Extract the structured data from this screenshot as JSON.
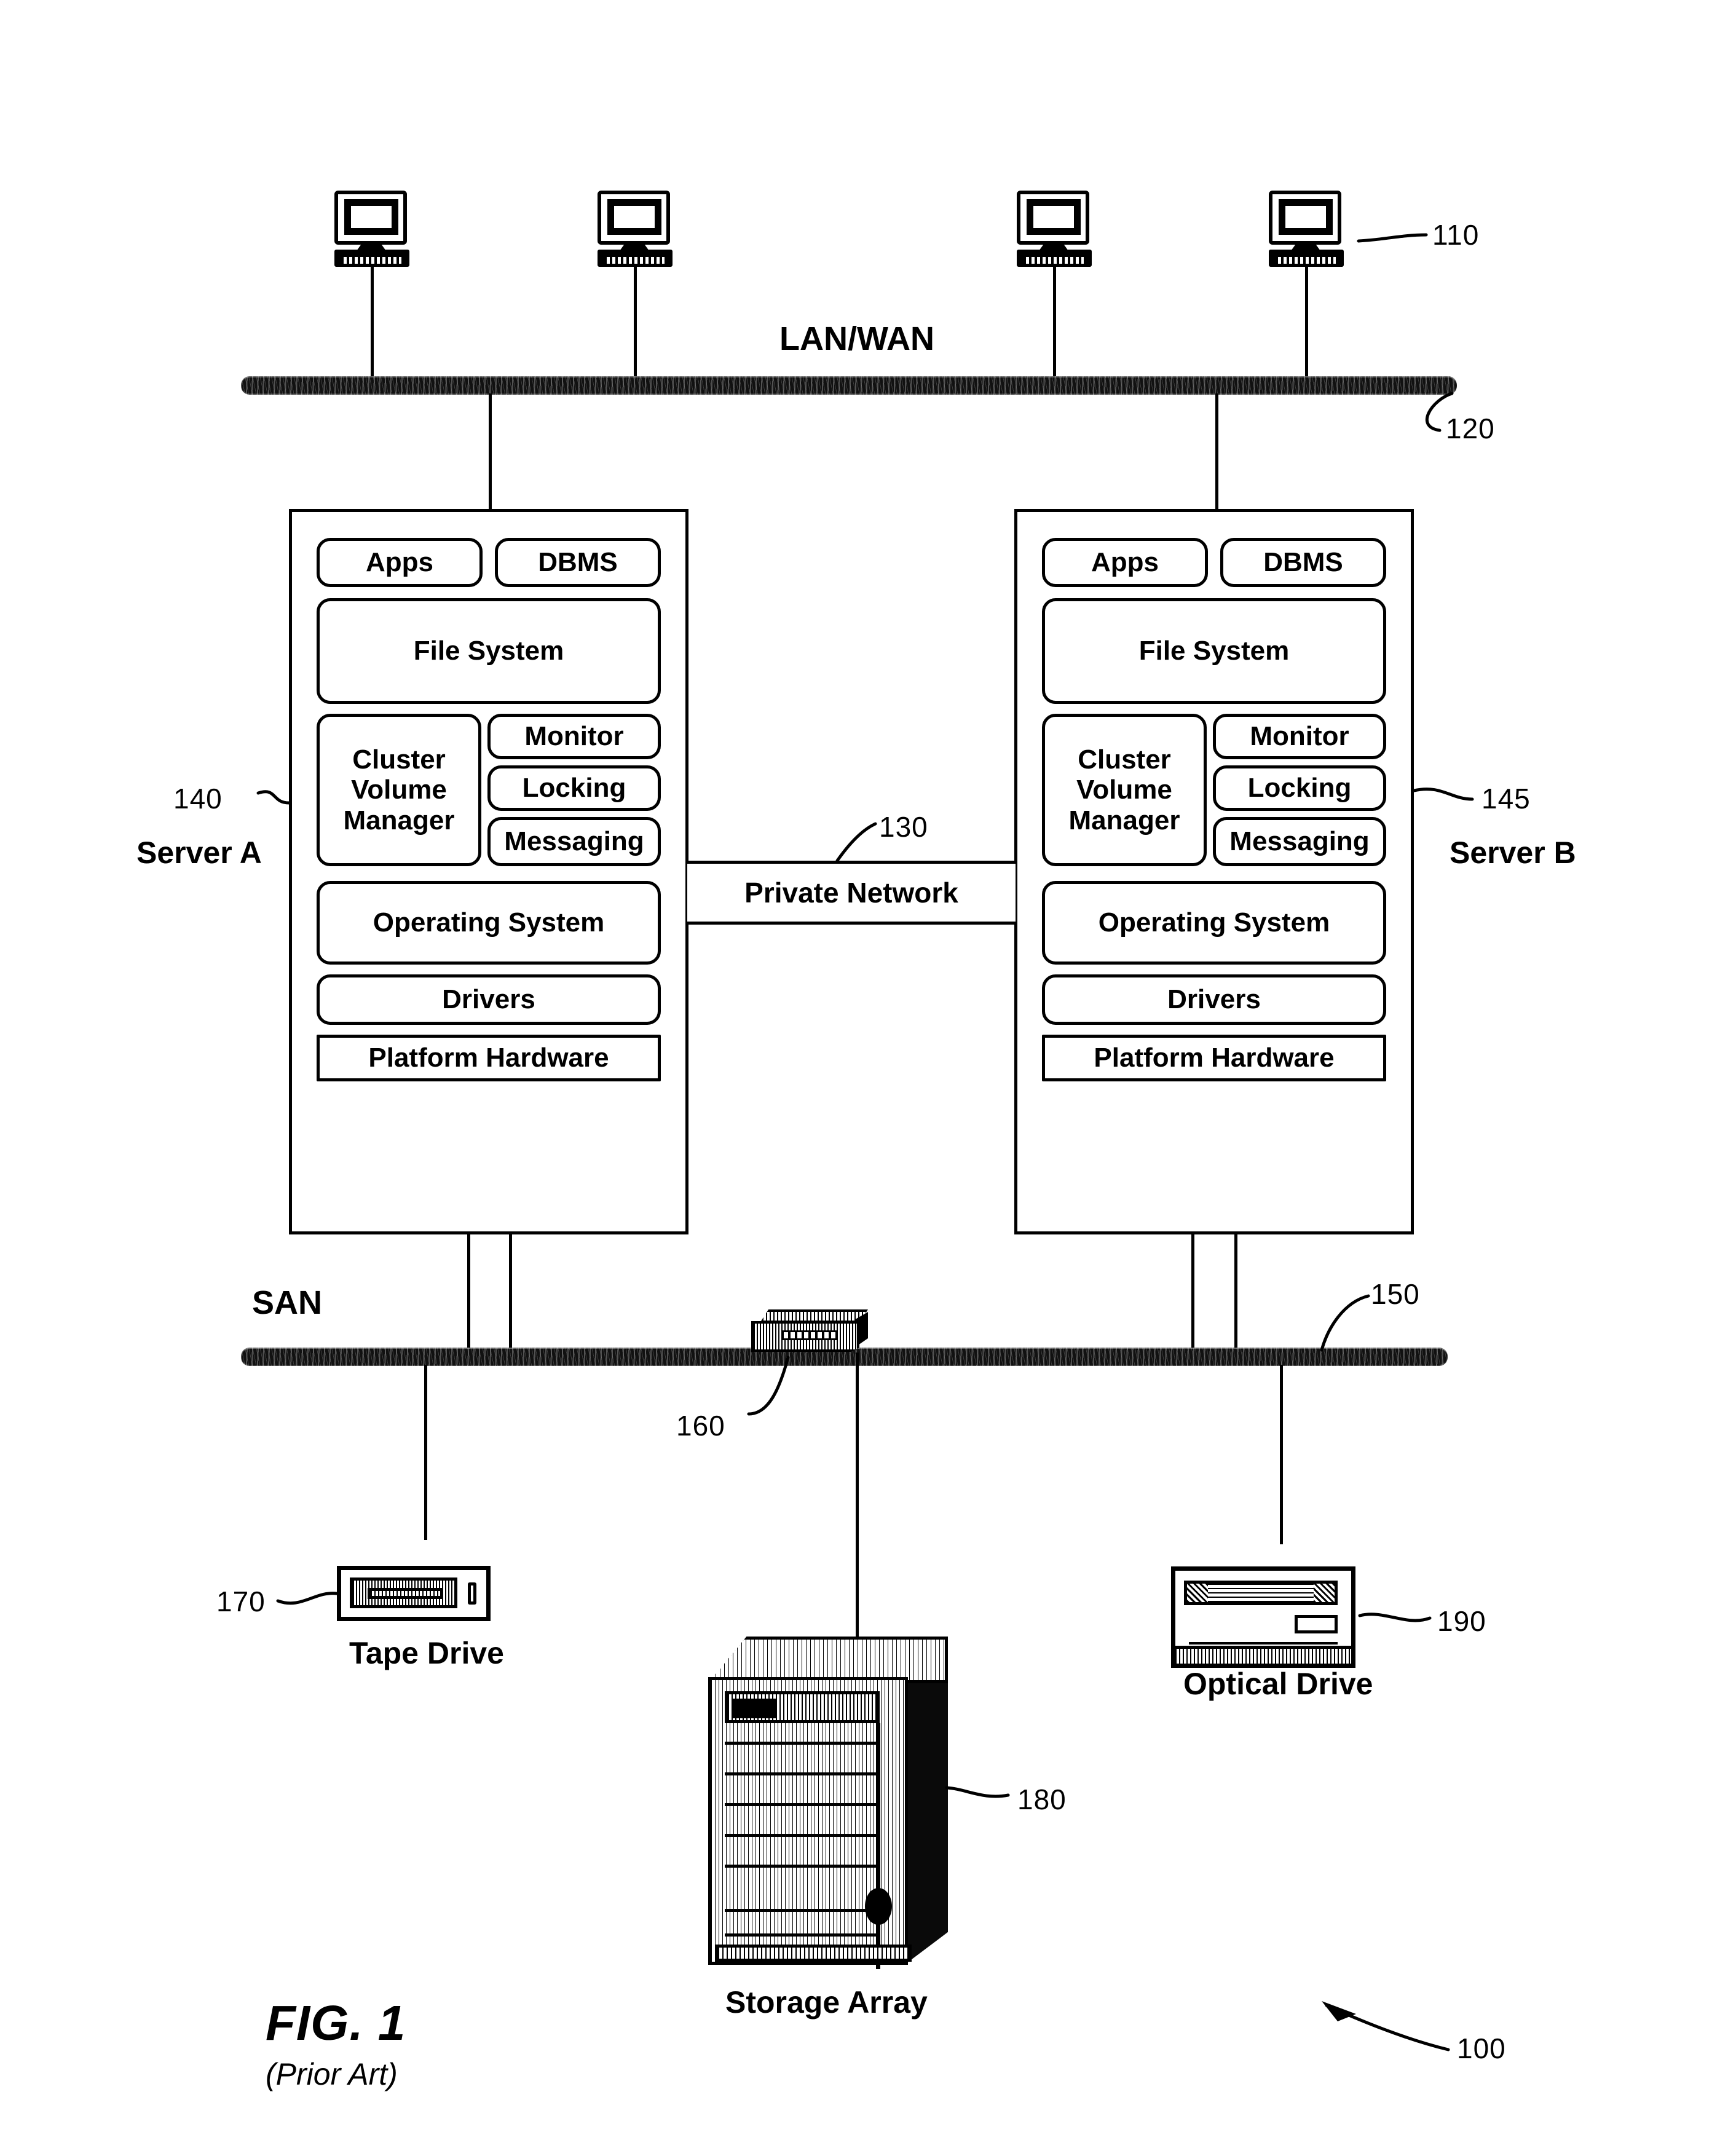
{
  "figure": {
    "title": "FIG. 1",
    "subtitle": "(Prior Art)",
    "system_ref": "100"
  },
  "network": {
    "lan_label": "LAN/WAN",
    "lan_ref": "120",
    "workstation_ref": "110",
    "san_label": "SAN",
    "san_ref": "150",
    "private_network_label": "Private Network",
    "private_network_ref": "130"
  },
  "servers": [
    {
      "name": "Server A",
      "ref": "140",
      "blocks": {
        "apps": "Apps",
        "dbms": "DBMS",
        "file_system": "File System",
        "cluster_volume_manager": "Cluster\nVolume\nManager",
        "monitor": "Monitor",
        "locking": "Locking",
        "messaging": "Messaging",
        "operating_system": "Operating System",
        "drivers": "Drivers",
        "platform_hardware": "Platform Hardware"
      }
    },
    {
      "name": "Server B",
      "ref": "145",
      "blocks": {
        "apps": "Apps",
        "dbms": "DBMS",
        "file_system": "File System",
        "cluster_volume_manager": "Cluster\nVolume\nManager",
        "monitor": "Monitor",
        "locking": "Locking",
        "messaging": "Messaging",
        "operating_system": "Operating System",
        "drivers": "Drivers",
        "platform_hardware": "Platform Hardware"
      }
    }
  ],
  "devices": {
    "switch_ref": "160",
    "tape_drive_label": "Tape Drive",
    "tape_drive_ref": "170",
    "storage_array_label": "Storage Array",
    "storage_array_ref": "180",
    "optical_drive_label": "Optical Drive",
    "optical_drive_ref": "190"
  },
  "colors": {
    "ink": "#000000",
    "paper": "#ffffff"
  }
}
